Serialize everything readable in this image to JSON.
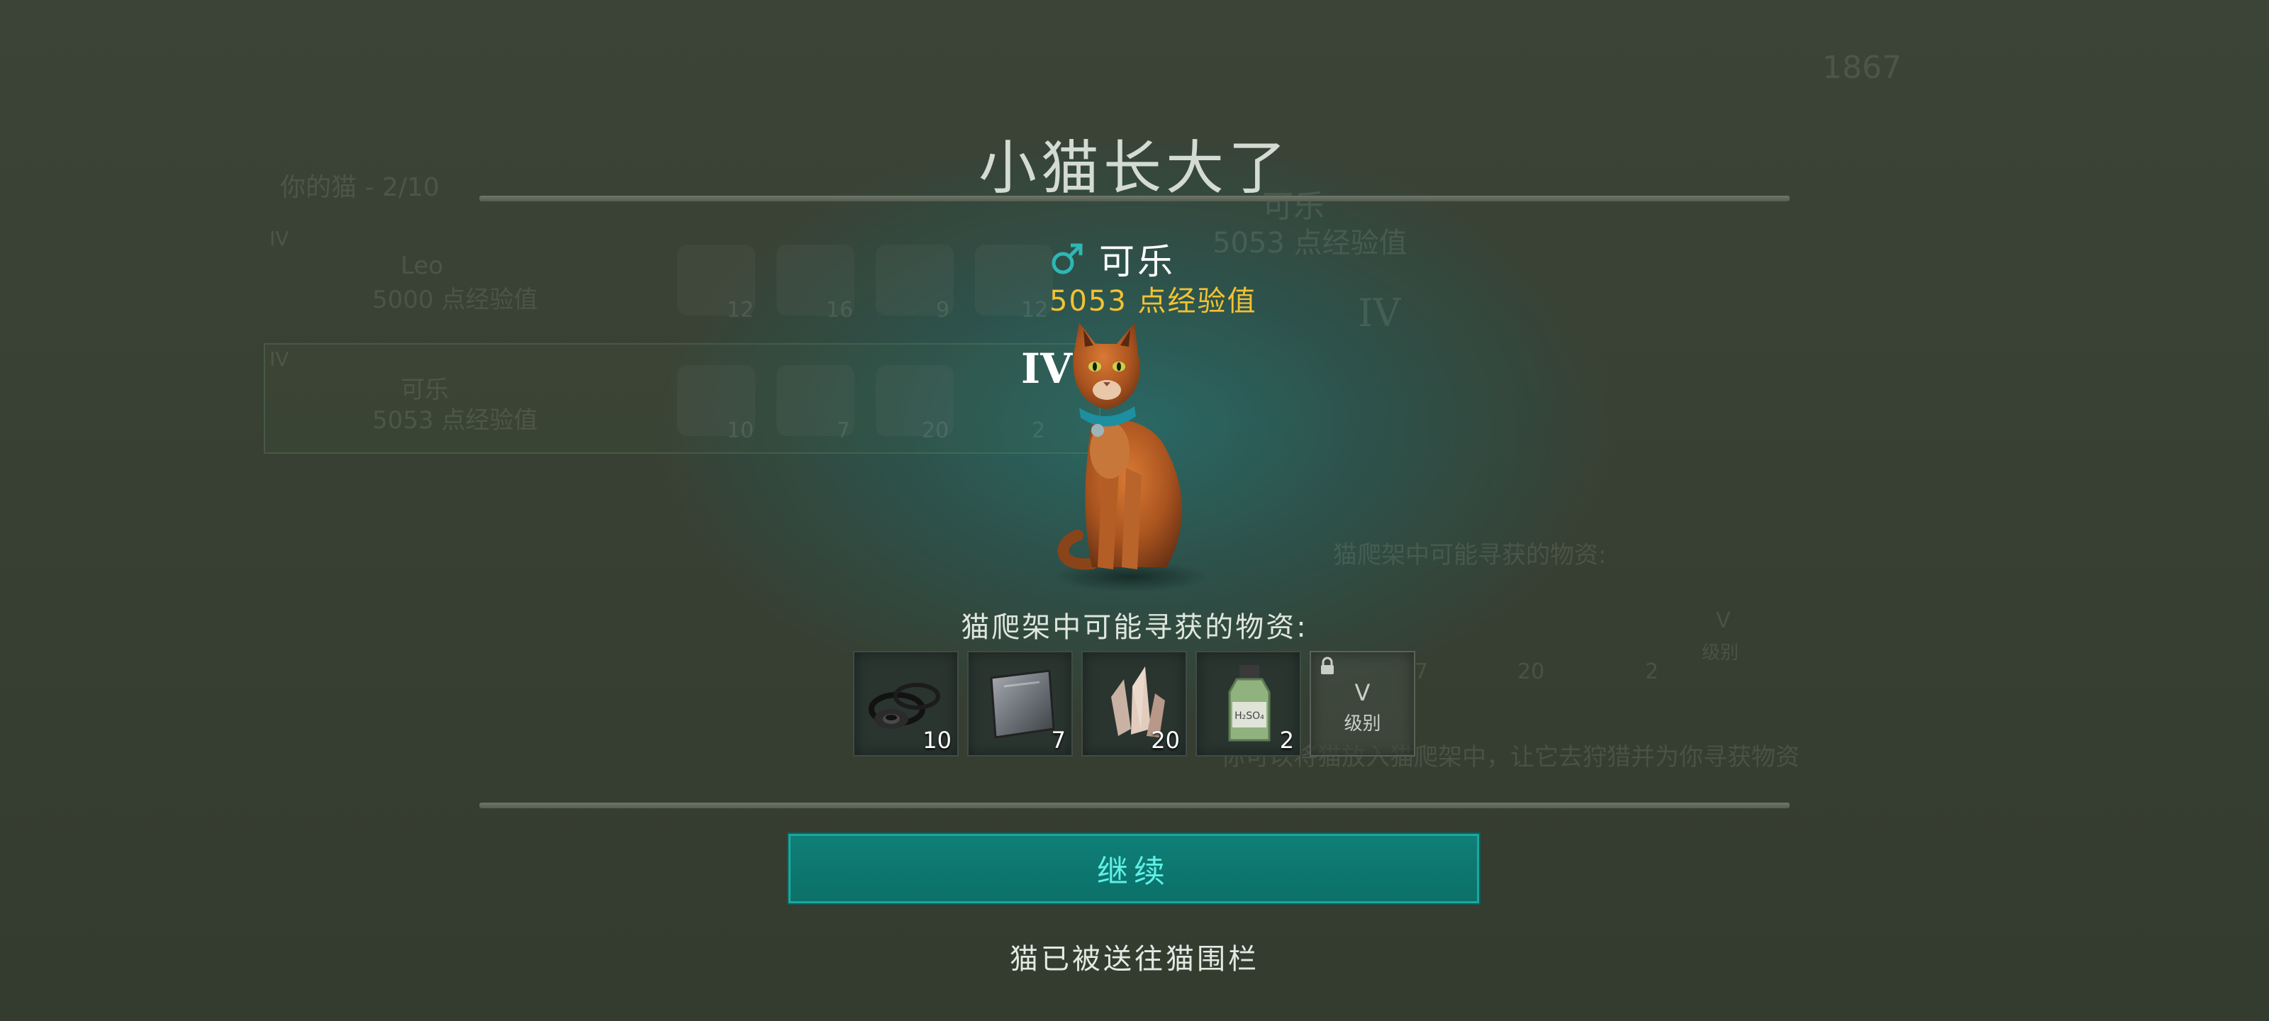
{
  "background": {
    "top_right_value": "1867",
    "side_panel_text": "你的猫 - 2/10",
    "list": [
      {
        "level": "IV",
        "name": "Leo",
        "exp": "5000 点经验值",
        "counts": [
          "12",
          "16",
          "9",
          "12"
        ]
      },
      {
        "level": "IV",
        "name": "可乐",
        "exp": "5053 点经验值",
        "counts": [
          "10",
          "7",
          "20",
          "2"
        ]
      }
    ],
    "detail_name": "可乐",
    "detail_exp": "5053 点经验值",
    "detail_level": "IV",
    "detail_loot_label": "猫爬架中可能寻获的物资:",
    "detail_counts": [
      "7",
      "20",
      "2"
    ],
    "detail_locked_level": "V",
    "detail_locked_text": "级别",
    "detail_hint": "你可以将猫放入猫爬架中，让它去狩猎并为你寻获物资"
  },
  "modal": {
    "title": "小猫长大了",
    "cat": {
      "gender_icon": "male-icon",
      "name": "可乐",
      "exp": "5053 点经验值",
      "level": "IV"
    },
    "loot_label": "猫爬架中可能寻获的物资:",
    "loot_items": [
      {
        "icon": "rubber-rings-icon",
        "count": "10"
      },
      {
        "icon": "metal-plate-icon",
        "count": "7"
      },
      {
        "icon": "quartz-crystal-icon",
        "count": "20"
      },
      {
        "icon": "chemical-bottle-icon",
        "count": "2"
      }
    ],
    "locked_slot": {
      "level": "V",
      "text": "级别",
      "icon": "lock-icon"
    },
    "continue_label": "继续",
    "footer": "猫已被送往猫围栏"
  },
  "colors": {
    "accent_teal": "#0f7f77",
    "exp_gold": "#f2c232",
    "gender_teal": "#2fb7b4"
  }
}
